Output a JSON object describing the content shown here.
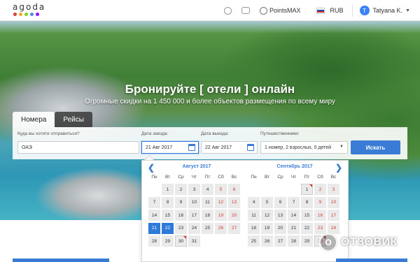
{
  "header": {
    "logo_text": "agoda",
    "logo_dot_colors": [
      "#e23b3b",
      "#f5a623",
      "#7ed321",
      "#4a90e2",
      "#9013fe"
    ],
    "pointsmax_label": "PointsMAX",
    "currency_label": "RUB",
    "user_initial": "T",
    "user_name": "Tatyana K."
  },
  "hero": {
    "title": "Бронируйте [ отели ] онлайн",
    "subtitle": "Огромные скидки на 1 450 000 и более объектов размещения по всему миру"
  },
  "search": {
    "tabs": [
      {
        "label": "Номера",
        "active": true
      },
      {
        "label": "Рейсы",
        "active": false
      }
    ],
    "destination_label": "Куда вы хотите отправиться?",
    "destination_value": "ОАЭ",
    "checkin_label": "Дата заезда:",
    "checkin_value": "21 Авг 2017",
    "checkout_label": "Дата выезда:",
    "checkout_value": "22 Авг 2017",
    "travelers_label": "Путешественники:",
    "travelers_value": "1 номер, 2 взрослых, 0 детей",
    "search_button": "Искать"
  },
  "calendar": {
    "weekdays": [
      "Пн",
      "Вт",
      "Ср",
      "Чт",
      "Пт",
      "Сб",
      "Вс"
    ],
    "months": [
      {
        "title": "Август 2017",
        "first_weekday_index": 1,
        "days": 31,
        "selected": [
          21,
          22
        ],
        "flagged": [
          30
        ]
      },
      {
        "title": "Сентябрь 2017",
        "first_weekday_index": 4,
        "days": 30,
        "selected": [],
        "flagged": [
          1,
          30
        ]
      }
    ]
  },
  "watermark": {
    "text": "ОТЗОВИК",
    "glyph": "O"
  }
}
